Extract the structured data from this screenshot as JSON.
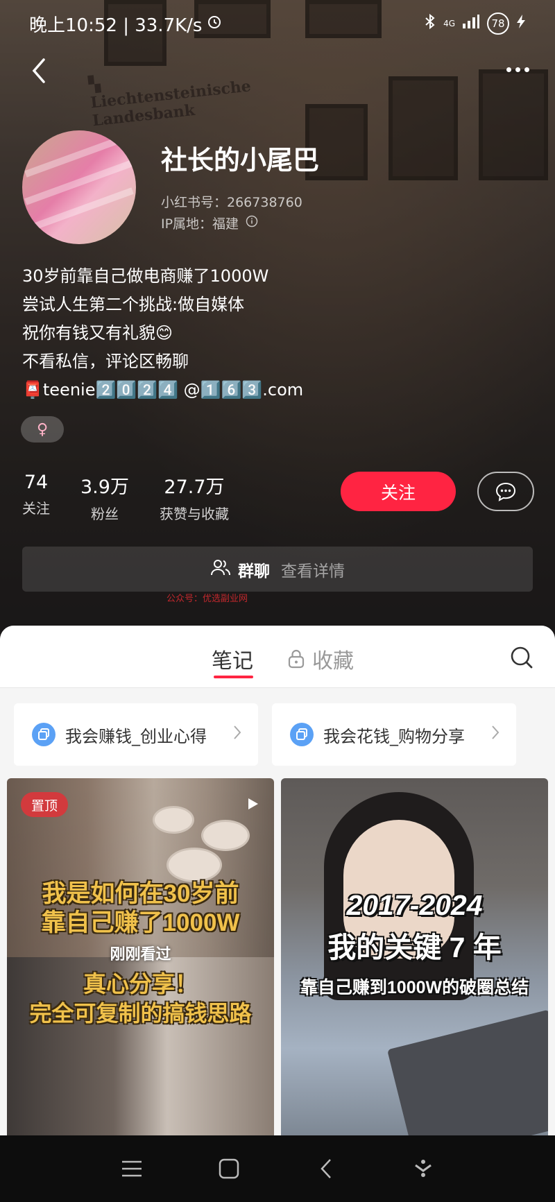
{
  "status_bar": {
    "time_speed": "晚上10:52 | 33.7K/s",
    "network": "4G",
    "battery": "78"
  },
  "profile": {
    "username": "社长的小尾巴",
    "id_line": "小红书号：266738760",
    "ip_line": "IP属地：福建",
    "bio": [
      "30岁前靠自己做电商赚了1000W",
      "尝试人生第二个挑战:做自媒体",
      "祝你有钱又有礼貌😊",
      "不看私信，评论区畅聊",
      "📮teenie2️⃣0️⃣2️⃣4️⃣ @1️⃣6️⃣3️⃣.com"
    ],
    "gender_symbol": "♀"
  },
  "stats": [
    {
      "value": "74",
      "label": "关注"
    },
    {
      "value": "3.9万",
      "label": "粉丝"
    },
    {
      "value": "27.7万",
      "label": "获赞与收藏"
    }
  ],
  "actions": {
    "follow_label": "关注"
  },
  "group_chat": {
    "title": "群聊",
    "detail": "查看详情"
  },
  "watermark": "公众号：优选副业网",
  "tabs": {
    "notes": "笔记",
    "favorites": "收藏"
  },
  "collections": [
    {
      "label": "我会赚钱_创业心得"
    },
    {
      "label": "我会花钱_购物分享"
    }
  ],
  "cards": [
    {
      "badge": "置顶",
      "line1": "我是如何在30岁前",
      "line2": "靠自己赚了1000W",
      "seen": "刚刚看过",
      "line3": "真心分享！",
      "line4": "完全可复制的搞钱思路"
    },
    {
      "line1": "2017-2024",
      "line2": "我的关键 7 年",
      "line3": "靠自己赚到1000W的破圈总结"
    }
  ],
  "colors": {
    "accent": "#ff2442",
    "collection_icon": "#5ba1f5"
  }
}
